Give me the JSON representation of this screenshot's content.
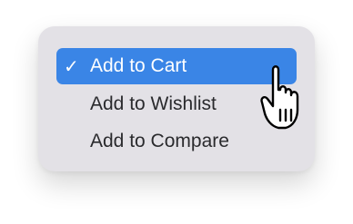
{
  "menu": {
    "items": [
      {
        "label": "Add to Cart",
        "selected": true
      },
      {
        "label": "Add to Wishlist",
        "selected": false
      },
      {
        "label": "Add to Compare",
        "selected": false
      }
    ],
    "check_glyph": "✓"
  },
  "cursor": {
    "icon": "pointing-hand-cursor-icon"
  },
  "colors": {
    "menu_background": "#e3e1e6",
    "highlight": "#3a85e6",
    "text": "#2a2a2d"
  }
}
